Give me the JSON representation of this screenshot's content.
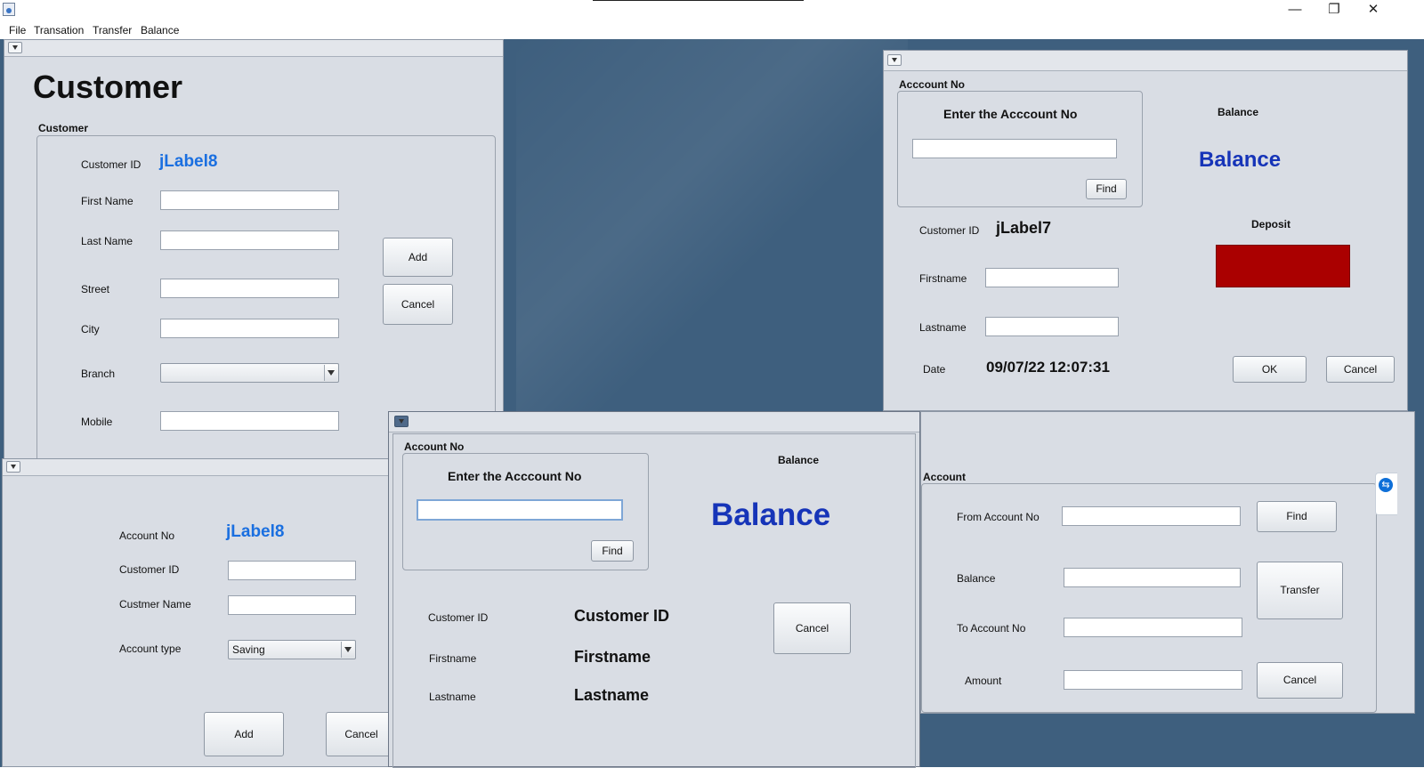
{
  "window": {
    "minimize": "—",
    "restore": "❐",
    "close": "✕"
  },
  "menu": [
    "File",
    "Transation",
    "Transfer",
    "Balance"
  ],
  "customer_frame": {
    "heading": "Customer",
    "group_title": "Customer",
    "customer_id_label": "Customer ID",
    "customer_id_value": "jLabel8",
    "first_name_label": "First Name",
    "last_name_label": "Last Name",
    "street_label": "Street",
    "city_label": "City",
    "branch_label": "Branch",
    "mobile_label": "Mobile",
    "add_button": "Add",
    "cancel_button": "Cancel"
  },
  "account_frame": {
    "account_no_label": "Account No",
    "account_no_value": "jLabel8",
    "customer_id_label": "Customer ID",
    "customer_name_label": "Custmer Name",
    "account_type_label": "Account type",
    "account_type_value": "Saving",
    "add_button": "Add",
    "cancel_button": "Cancel"
  },
  "deposit_frame": {
    "group_title": "Acccount No",
    "enter_label": "Enter the Acccount No",
    "find_button": "Find",
    "balance_label": "Balance",
    "balance_value": "Balance",
    "customer_id_label": "Customer ID",
    "customer_id_value": "jLabel7",
    "firstname_label": "Firstname",
    "lastname_label": "Lastname",
    "date_label": "Date",
    "date_value": "09/07/22 12:07:31",
    "deposit_label": "Deposit",
    "ok_button": "OK",
    "cancel_button": "Cancel",
    "colors": {
      "deposit_field": "#aa0000"
    }
  },
  "balance_frame": {
    "group_title": "Account No",
    "enter_label": "Enter the Acccount No",
    "find_button": "Find",
    "balance_label": "Balance",
    "balance_value": "Balance",
    "customer_id_label": "Customer ID",
    "customer_id_value": "Customer ID",
    "firstname_label": "Firstname",
    "firstname_value": "Firstname",
    "lastname_label": "Lastname",
    "lastname_value": "Lastname",
    "cancel_button": "Cancel"
  },
  "transfer_frame": {
    "group_title": "Account",
    "from_label": "From Account No",
    "find_button": "Find",
    "balance_label": "Balance",
    "transfer_button": "Transfer",
    "to_label": "To  Account No",
    "amount_label": "Amount",
    "cancel_button": "Cancel"
  }
}
